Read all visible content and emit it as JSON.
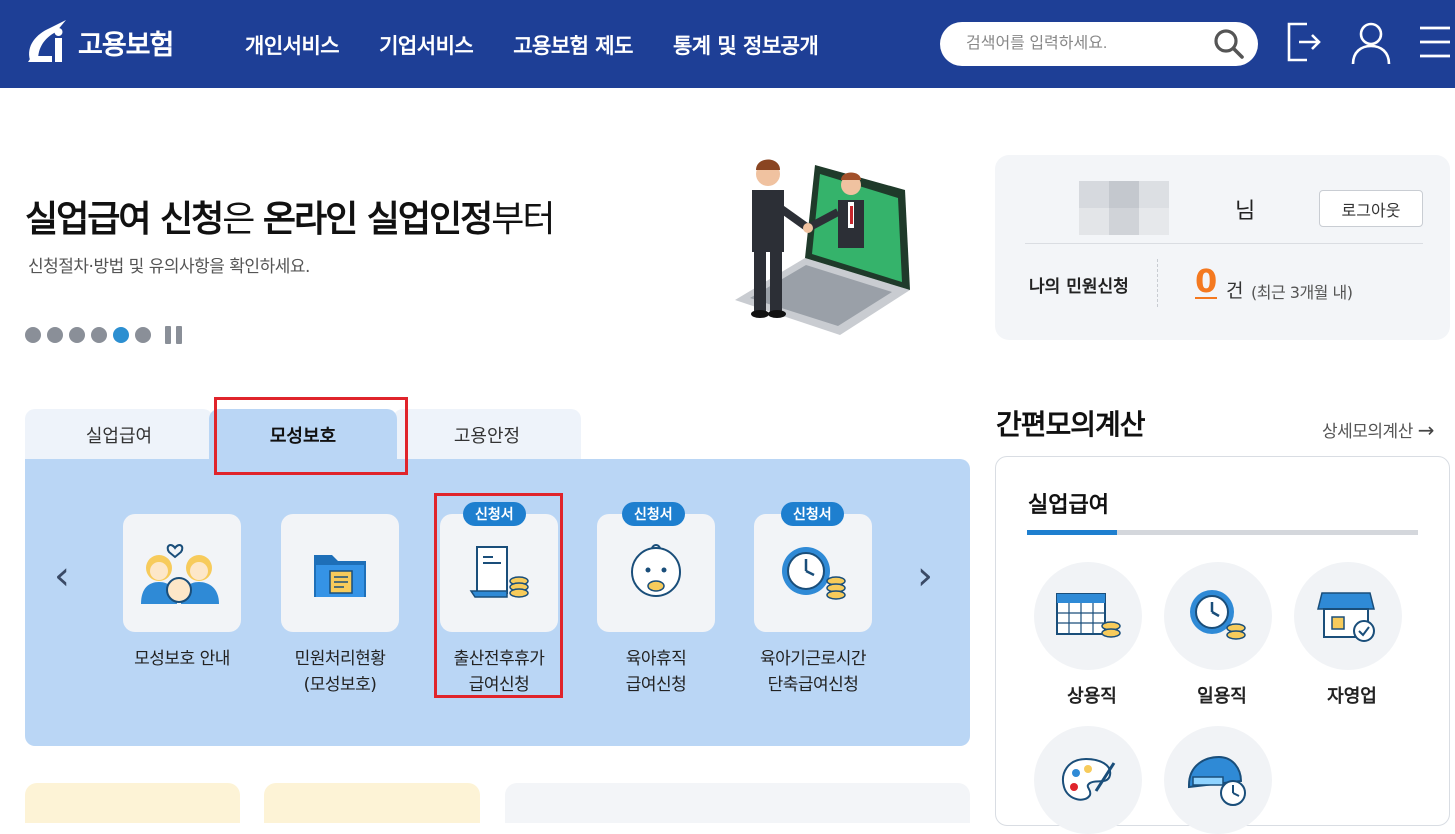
{
  "header": {
    "logo_text": "고용보험",
    "nav": [
      "개인서비스",
      "기업서비스",
      "고용보험 제도",
      "통계 및 정보공개"
    ],
    "search_placeholder": "검색어를 입력하세요."
  },
  "hero": {
    "title_bold1": "실업급여 신청",
    "title_light1": "은 ",
    "title_bold2": "온라인 실업인정",
    "title_light2": "부터",
    "subtitle": "신청절차·방법 및 유의사항을 확인하세요.",
    "slide_count": 6,
    "active_slide": 5
  },
  "login": {
    "suffix": "님",
    "logout_label": "로그아웃",
    "my_label": "나의 민원신청",
    "count": "0",
    "count_unit": "건",
    "count_note": "(최근 3개월 내)"
  },
  "tabs": [
    {
      "label": "실업급여",
      "active": false
    },
    {
      "label": "모성보호",
      "active": true
    },
    {
      "label": "고용안정",
      "active": false
    }
  ],
  "services": [
    {
      "label": "모성보호 안내",
      "badge": ""
    },
    {
      "label": "민원처리현황\n(모성보호)",
      "badge": ""
    },
    {
      "label": "출산전후휴가\n급여신청",
      "badge": "신청서"
    },
    {
      "label": "육아휴직\n급여신청",
      "badge": "신청서"
    },
    {
      "label": "육아기근로시간\n단축급여신청",
      "badge": "신청서"
    }
  ],
  "calc": {
    "title": "간편모의계산",
    "more_label": "상세모의계산",
    "subtitle": "실업급여",
    "items": [
      "상용직",
      "일용직",
      "자영업"
    ]
  },
  "colors": {
    "header_bg": "#1e3f96",
    "panel_bg": "#bad6f5",
    "accent": "#1e7fcf",
    "count": "#f47920",
    "highlight": "#e0242b"
  }
}
